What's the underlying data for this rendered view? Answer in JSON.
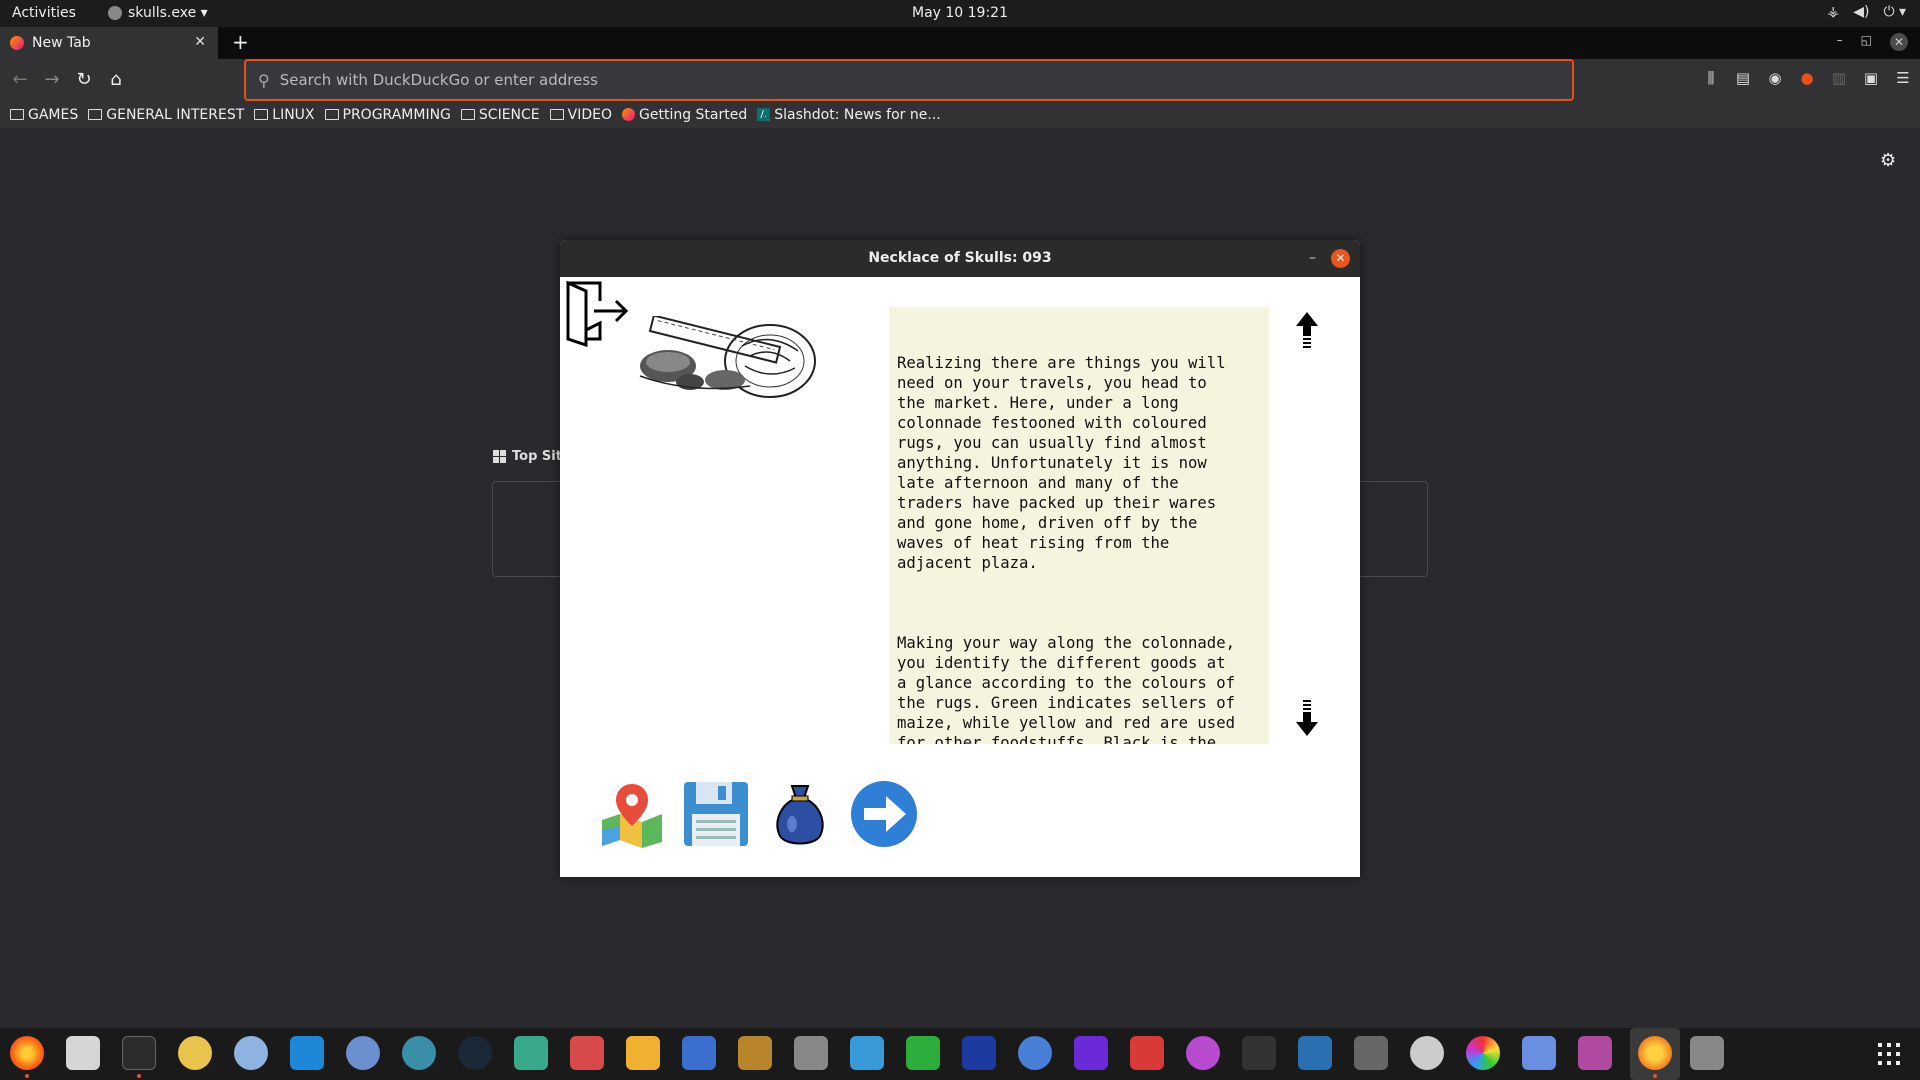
{
  "topbar": {
    "activities": "Activities",
    "app_menu": "skulls.exe ▾",
    "clock": "May 10  19:21"
  },
  "browser": {
    "tab_title": "New Tab",
    "url_placeholder": "Search with DuckDuckGo or enter address",
    "bookmarks": [
      {
        "label": "GAMES",
        "icon": "folder-icon"
      },
      {
        "label": "GENERAL INTEREST",
        "icon": "folder-icon"
      },
      {
        "label": "LINUX",
        "icon": "folder-icon"
      },
      {
        "label": "PROGRAMMING",
        "icon": "folder-icon"
      },
      {
        "label": "SCIENCE",
        "icon": "folder-icon"
      },
      {
        "label": "VIDEO",
        "icon": "folder-icon"
      },
      {
        "label": "Getting Started",
        "icon": "firefox-icon"
      },
      {
        "label": "Slashdot: News for ne...",
        "icon": "slashdot-icon"
      }
    ],
    "top_sites_label": "Top Sit"
  },
  "game": {
    "window_title": "Necklace of Skulls: 093",
    "paragraphs": [
      "Realizing there are things you will\nneed on your travels, you head to\nthe market. Here, under a long\ncolonnade festooned with coloured\nrugs, you can usually find almost\nanything. Unfortunately it is now\nlate afternoon and many of the\ntraders have packed up their wares\nand gone home, driven off by the\nwaves of heat rising from the\nadjacent plaza.",
      "Making your way along the colonnade,\nyou identify the different goods at\na glance according to the colours of\nthe rugs. Green indicates sellers of\nmaize, while yellow and red are used\nfor other foodstuffs. Black is the\ncolour of stone or glass items, with\nthe addition of grey frets\nsignifying weaponry. Wooden products"
    ],
    "panel_bg": "#f5f4df"
  },
  "dock": {
    "icons": [
      "firefox-icon",
      "files-icon",
      "terminal-icon",
      "trophy-icon",
      "chrome-icon",
      "vscode-icon",
      "r-icon",
      "browser-icon",
      "steam-icon",
      "alien-icon",
      "crab-icon",
      "money-icon",
      "rocket-icon",
      "dosbox-icon",
      "controller-icon",
      "dolphin-icon",
      "s-icon",
      "mame-icon",
      "swirl-icon",
      "bar-icon",
      "diamond-icon",
      "grape-icon",
      "horse-icon",
      "chart-icon",
      "telescope-icon",
      "disc-icon",
      "color-wheel-icon",
      "screenshot-icon",
      "window-icon",
      "skulls-app-icon",
      "drive-icon"
    ]
  }
}
